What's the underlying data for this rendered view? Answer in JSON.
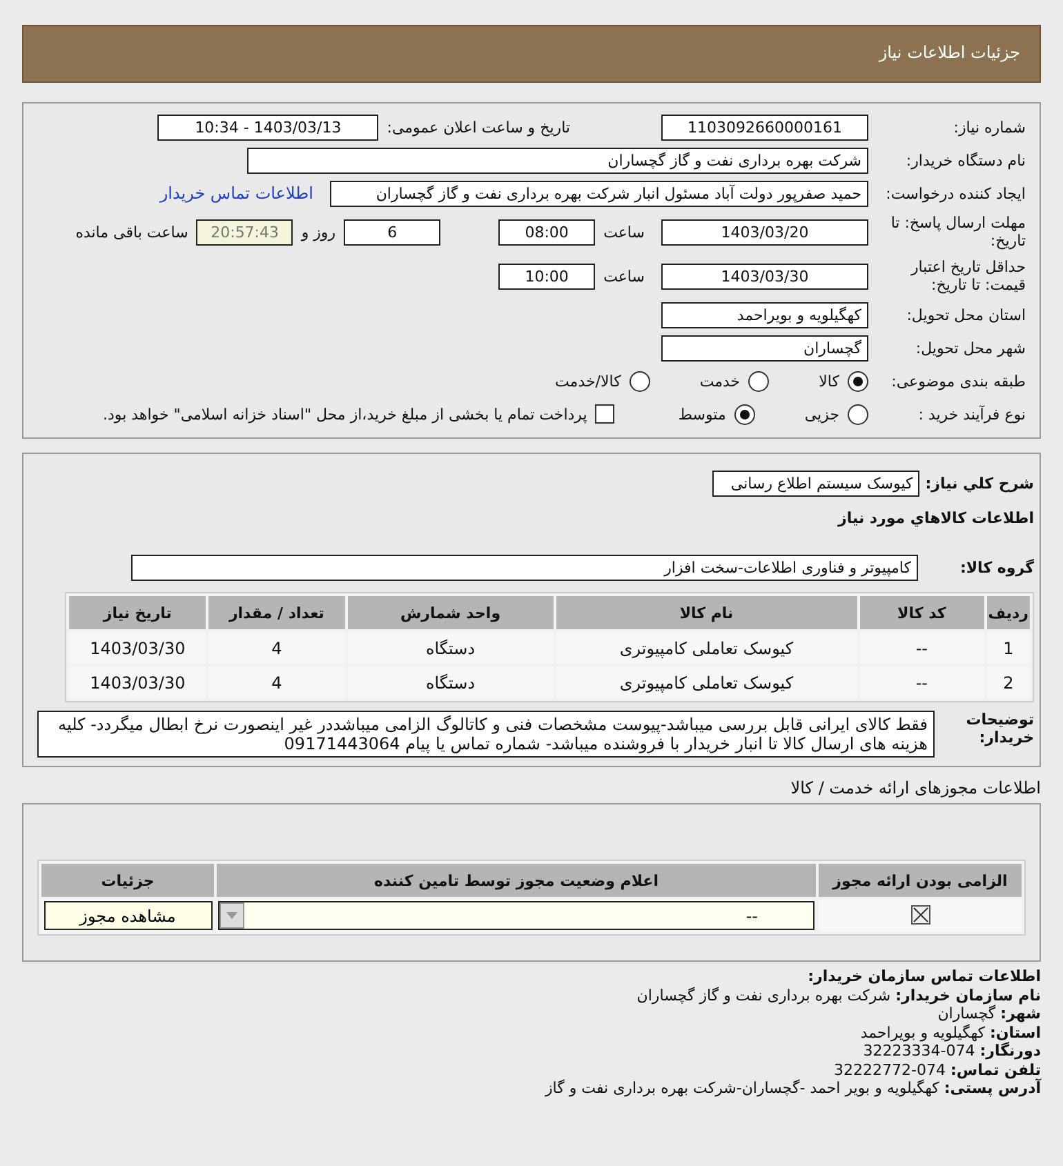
{
  "page_title": "جزئیات اطلاعات نیاز",
  "need_info": {
    "need_number": {
      "label": "شماره نیاز:",
      "value": "1103092660000161"
    },
    "announce": {
      "label": "تاریخ و ساعت اعلان عمومی:",
      "value": "1403/03/13 - 10:34"
    },
    "buyer": {
      "label": "نام دستگاه خریدار:",
      "value": "شرکت بهره برداری نفت و گاز گچساران"
    },
    "requester": {
      "label": "ایجاد کننده درخواست:",
      "value": "حمید  صفرپور دولت آباد مسئول انبار شرکت بهره برداری نفت و گاز گچساران",
      "link": "اطلاعات تماس خریدار"
    },
    "deadline": {
      "label": "مهلت ارسال پاسخ: تا تاریخ:",
      "date": "1403/03/20",
      "time_label": "ساعت",
      "time": "08:00",
      "days": "6",
      "days_label": "روز و",
      "remaining": "20:57:43",
      "remaining_label": "ساعت باقی مانده"
    },
    "validity": {
      "label": "حداقل تاریخ اعتبار قیمت: تا تاریخ:",
      "date": "1403/03/30",
      "time_label": "ساعت",
      "time": "10:00"
    },
    "province": {
      "label": "استان محل تحویل:",
      "value": "کهگیلویه و بویراحمد"
    },
    "city": {
      "label": "شهر محل تحویل:",
      "value": "گچساران"
    },
    "category": {
      "label": "طبقه بندی موضوعی:",
      "options": [
        {
          "label": "کالا",
          "selected": true
        },
        {
          "label": "خدمت",
          "selected": false
        },
        {
          "label": "کالا/خدمت",
          "selected": false
        }
      ]
    },
    "purchase_type": {
      "label": "نوع فرآیند خرید :",
      "options": [
        {
          "label": "جزیی",
          "selected": false
        },
        {
          "label": "متوسط",
          "selected": true
        }
      ],
      "payment": {
        "label": "پرداخت تمام یا بخشی از مبلغ خرید،از محل \"اسناد خزانه اسلامی\" خواهد بود.",
        "checked": false
      }
    }
  },
  "goods": {
    "description": {
      "label": "شرح کلي نياز:",
      "value": "کیوسک سیستم اطلاع رسانی"
    },
    "heading": "اطلاعات کالاهاي مورد نياز",
    "group": {
      "label": "گروه کالا:",
      "value": "کامپیوتر و فناوری اطلاعات-سخت افزار"
    },
    "columns": [
      "رديف",
      "کد کالا",
      "نام کالا",
      "واحد شمارش",
      "تعداد / مقدار",
      "تاریخ نیاز"
    ],
    "rows": [
      [
        "1",
        "--",
        "کیوسک تعاملی کامپیوتری",
        "دستگاه",
        "4",
        "1403/03/30"
      ],
      [
        "2",
        "--",
        "کیوسک تعاملی کامپیوتری",
        "دستگاه",
        "4",
        "1403/03/30"
      ]
    ],
    "notes": {
      "label": "توضیحات خریدار:",
      "value": "فقط کالای ایرانی قابل بررسی میباشد-پیوست مشخصات فنی و کاتالوگ الزامی میباشددر غیر اینصورت نرخ ابطال میگردد- کلیه هزینه های ارسال کالا تا انبار خریدار با فروشنده میباشد- شماره تماس یا پیام 09171443064"
    }
  },
  "licenses": {
    "title": "اطلاعات مجوزهای ارائه خدمت / کالا",
    "columns": [
      "الزامی بودن ارائه مجوز",
      "اعلام وضعیت مجوز توسط تامین کننده",
      "جزئیات"
    ],
    "rows": [
      {
        "required": true,
        "status": "--",
        "button": "مشاهده مجوز"
      }
    ]
  },
  "contact": {
    "heading": "اطلاعات تماس سازمان خریدار:",
    "lines": [
      {
        "label": "نام سازمان خریدار:",
        "value": "شرکت بهره برداری نفت و گاز گچساران"
      },
      {
        "label": "شهر:",
        "value": "گچساران"
      },
      {
        "label": "استان:",
        "value": "کهگیلویه و بویراحمد"
      },
      {
        "label": "دورنگار:",
        "value": "074-32223334"
      },
      {
        "label": "تلفن تماس:",
        "value": "074-32222772"
      },
      {
        "label": "آدرس پستی:",
        "value": "کهگیلویه و بویر احمد -گچساران-شرکت بهره برداری نفت و گاز"
      }
    ]
  }
}
